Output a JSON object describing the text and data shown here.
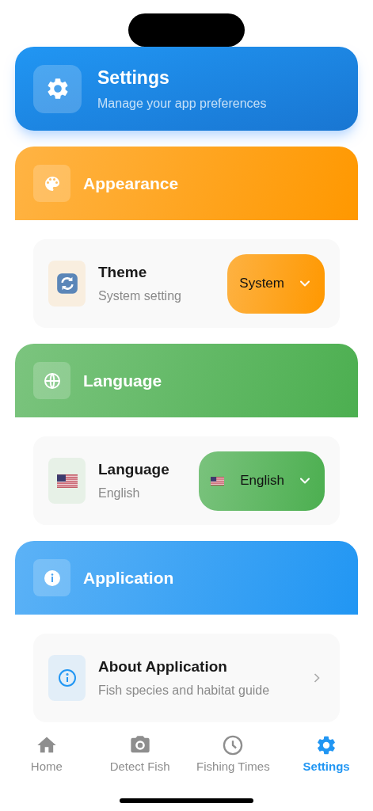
{
  "header": {
    "title": "Settings",
    "subtitle": "Manage your app preferences"
  },
  "sections": [
    {
      "title": "Appearance",
      "color": "#ff9800",
      "item": {
        "kind": "dropdown",
        "title": "Theme",
        "subtitle": "System setting",
        "value": "System",
        "flag": false
      }
    },
    {
      "title": "Language",
      "color": "#4caf50",
      "item": {
        "kind": "dropdown",
        "title": "Language",
        "subtitle": "English",
        "value": "English",
        "flag": true
      }
    },
    {
      "title": "Application",
      "color": "#2196f3",
      "item": {
        "kind": "link",
        "title": "About Application",
        "subtitle": "Fish species and habitat guide"
      }
    }
  ],
  "tabs": [
    {
      "label": "Home",
      "selected": false
    },
    {
      "label": "Detect Fish",
      "selected": false
    },
    {
      "label": "Fishing Times",
      "selected": false
    },
    {
      "label": "Settings",
      "selected": true
    }
  ]
}
